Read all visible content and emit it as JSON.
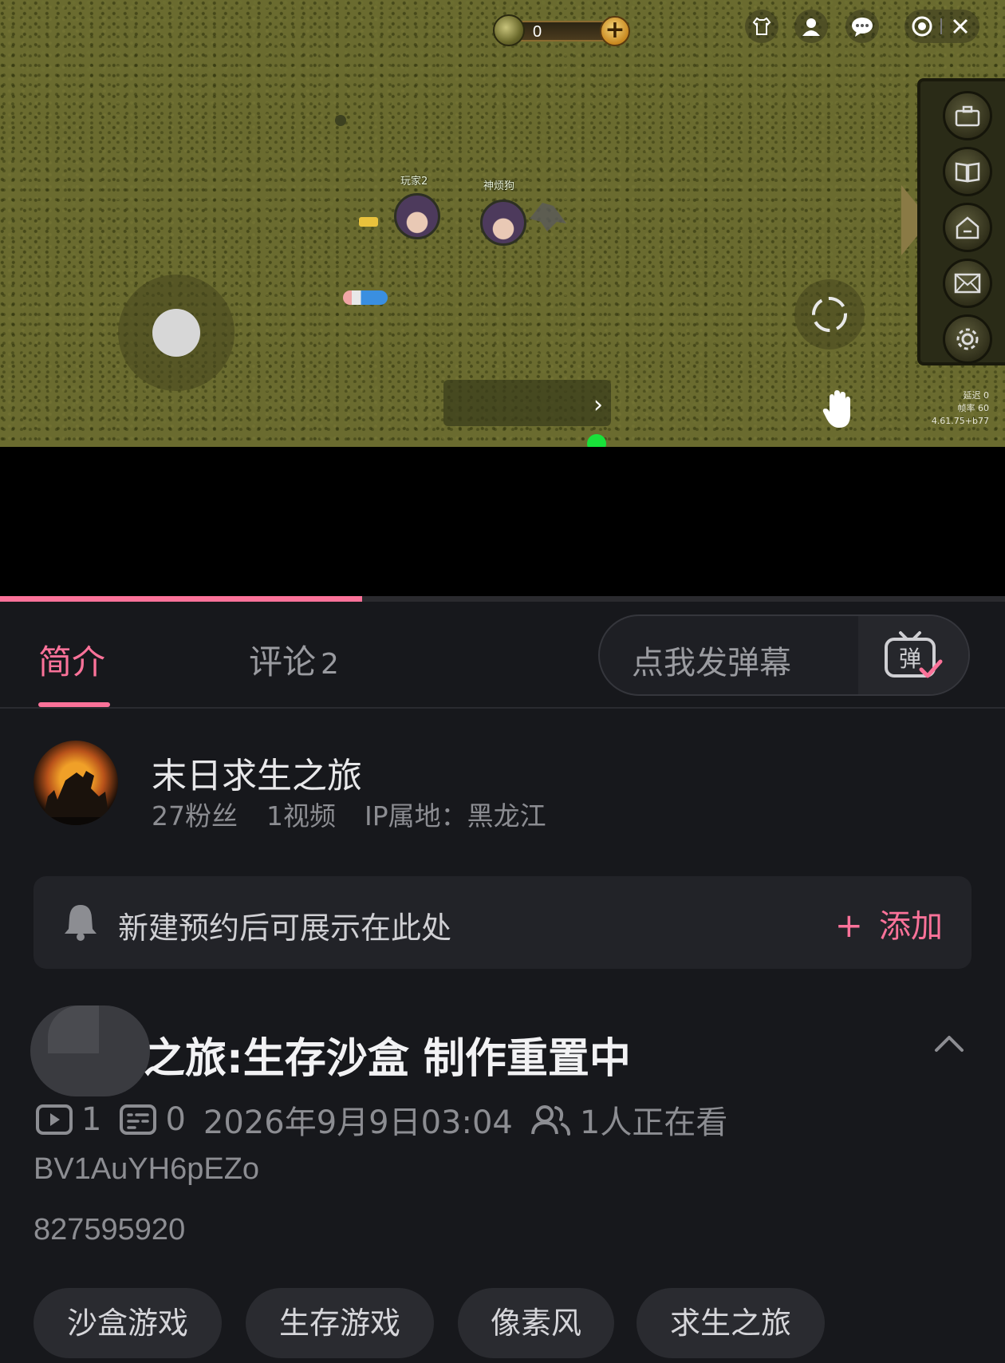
{
  "game": {
    "coins": "0",
    "player_labels": [
      "玩家2",
      "神烦狗"
    ],
    "stats_lines": [
      "延迟 0",
      "帧率 60",
      "4.61.75+b77"
    ],
    "progress_percent": 36
  },
  "tabs": {
    "intro": "简介",
    "comments": "评论",
    "comments_count": "2"
  },
  "danmaku": {
    "placeholder": "点我发弹幕",
    "button_glyph": "弹"
  },
  "author": {
    "name": "末日求生之旅",
    "fans": "27粉丝",
    "videos": "1视频",
    "ip": "IP属地：黑龙江"
  },
  "reservation": {
    "text": "新建预约后可展示在此处",
    "add_label": "添加"
  },
  "video": {
    "title": "之旅:生存沙盒 制作重置中",
    "plays": "1",
    "danmaku_count": "0",
    "date": "2026年9月9日03:04",
    "watching": "1人正在看",
    "bvid": "BV1AuYH6pEZo",
    "aid": "827595920"
  },
  "tags": [
    "沙盒游戏",
    "生存游戏",
    "像素风",
    "求生之旅"
  ],
  "colors": {
    "accent": "#fb7299",
    "background": "#17181c"
  }
}
